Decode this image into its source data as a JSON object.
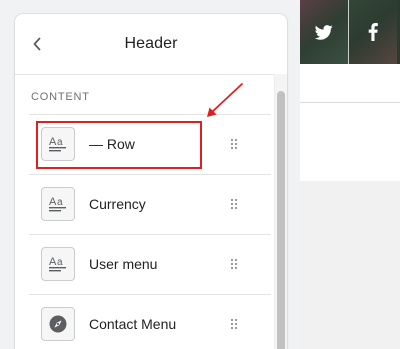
{
  "panel": {
    "title": "Header",
    "back_icon": "chevron-left-icon"
  },
  "section": {
    "label": "CONTENT"
  },
  "items": [
    {
      "label": "— Row",
      "icon": "text-block-icon"
    },
    {
      "label": "Currency",
      "icon": "text-block-icon"
    },
    {
      "label": "User menu",
      "icon": "text-block-icon"
    },
    {
      "label": "Contact Menu",
      "icon": "compass-icon"
    }
  ],
  "preview": {
    "social_icons": [
      "twitter-icon",
      "facebook-icon"
    ]
  },
  "annotation": {
    "color": "#e02020"
  }
}
